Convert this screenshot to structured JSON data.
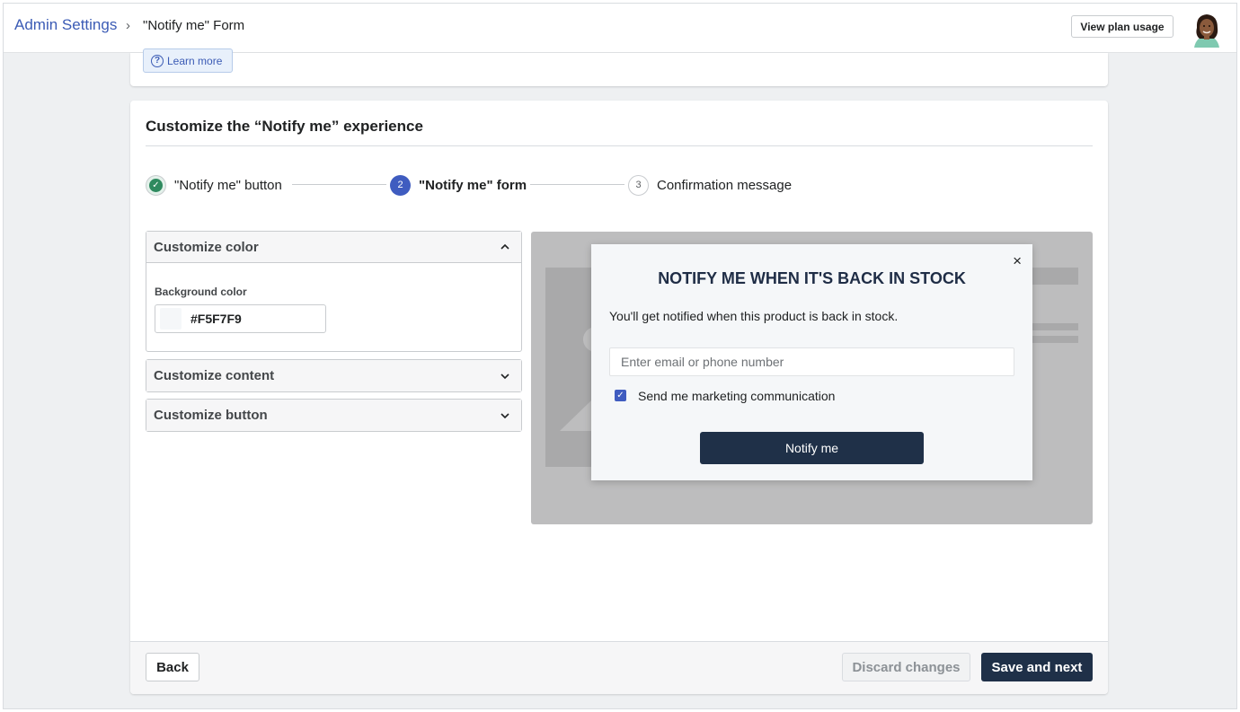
{
  "header": {
    "breadcrumb_root": "Admin Settings",
    "breadcrumb_separator": "›",
    "breadcrumb_current": "\"Notify me\" Form",
    "view_plan_usage": "View plan usage"
  },
  "top_card": {
    "learn_more": "Learn more",
    "help_glyph": "?"
  },
  "main_card": {
    "title": "Customize the “Notify me” experience",
    "steps": [
      {
        "label": "\"Notify me\" button",
        "marker": "✓",
        "state": "complete"
      },
      {
        "label": "\"Notify me\" form",
        "marker": "2",
        "state": "current"
      },
      {
        "label": "Confirmation message",
        "marker": "3",
        "state": "upcoming"
      }
    ],
    "accordions": {
      "color": {
        "title": "Customize color",
        "chevron": "⌃",
        "expanded": true
      },
      "content": {
        "title": "Customize content",
        "chevron": "⌄",
        "expanded": false
      },
      "button": {
        "title": "Customize button",
        "chevron": "⌄",
        "expanded": false
      }
    },
    "background_color": {
      "label": "Background color",
      "value": "#F5F7F9"
    },
    "preview": {
      "close_glyph": "×",
      "title": "NOTIFY ME WHEN IT'S BACK IN STOCK",
      "description": "You'll get notified when this product is back in stock.",
      "input_placeholder": "Enter email or phone number",
      "checkbox_checked": true,
      "checkbox_glyph": "✓",
      "checkbox_label": "Send me marketing communication",
      "button_label": "Notify me"
    },
    "footer": {
      "back": "Back",
      "discard": "Discard changes",
      "save": "Save and next"
    }
  },
  "colors": {
    "accent": "#3f5cc0",
    "link": "#3b5bb5",
    "primary_button": "#1f3048",
    "success": "#2f8a5f",
    "modal_background": "#F5F7F9"
  }
}
